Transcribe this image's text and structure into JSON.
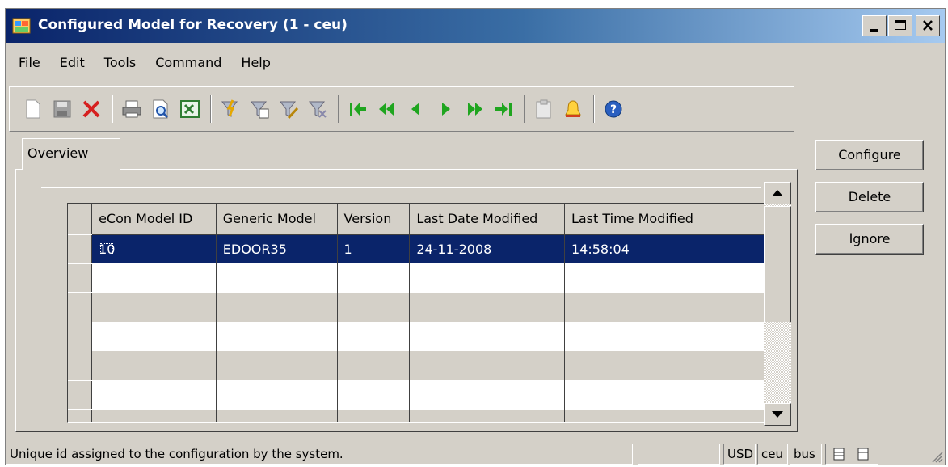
{
  "window": {
    "title": "Configured Model for Recovery (1 - ceu)",
    "title_bar_color": "#0a246a",
    "controls": [
      "minimize-icon",
      "maximize-icon",
      "close-icon"
    ]
  },
  "menu": [
    {
      "label": "File"
    },
    {
      "label": "Edit"
    },
    {
      "label": "Tools"
    },
    {
      "label": "Command"
    },
    {
      "label": "Help"
    }
  ],
  "toolbar": {
    "icons": [
      "new-icon",
      "save-icon",
      "delete-icon",
      "print-icon",
      "print-preview-icon",
      "export-excel-icon",
      "filter-by-selection-icon",
      "filter-by-grid-icon",
      "advanced-filter-icon",
      "remove-filter-icon",
      "first-record-icon",
      "previous-page-icon",
      "previous-record-icon",
      "next-record-icon",
      "next-page-icon",
      "last-record-icon",
      "document-handling-icon",
      "alert-icon",
      "help-icon"
    ]
  },
  "tabs": [
    {
      "label": "Overview"
    }
  ],
  "grid": {
    "columns": [
      "eCon Model ID",
      "Generic Model",
      "Version",
      "Last Date Modified",
      "Last Time Modified"
    ],
    "rows": [
      {
        "model_id": "10",
        "generic_model": "EDOOR35",
        "version": "1",
        "date": "24-11-2008",
        "time": "14:58:04"
      }
    ],
    "selection_color": "#0a246a"
  },
  "buttons": {
    "configure": "Configure",
    "delete": "Delete",
    "ignore": "Ignore"
  },
  "status": {
    "help_text": "Unique id assigned to the configuration by the system.",
    "currency": "USD",
    "company": "ceu",
    "user": "bus"
  }
}
